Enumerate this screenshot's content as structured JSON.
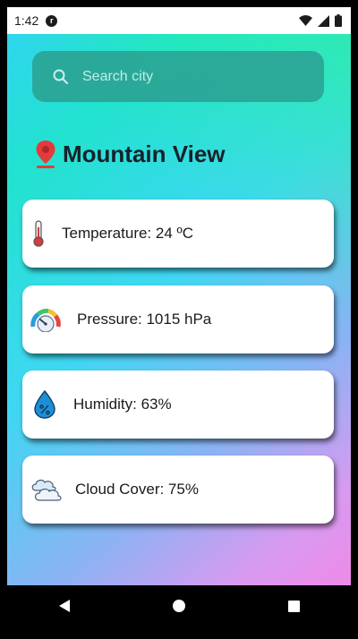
{
  "status_bar": {
    "time": "1:42",
    "app_icon_letter": "r"
  },
  "search": {
    "placeholder": "Search city",
    "icon": "search-icon"
  },
  "location": {
    "city": "Mountain View",
    "icon": "map-pin-icon"
  },
  "weather_cards": [
    {
      "icon": "thermometer-icon",
      "text": "Temperature: 24 ºC"
    },
    {
      "icon": "pressure-gauge-icon",
      "text": "Pressure: 1015 hPa"
    },
    {
      "icon": "humidity-drop-icon",
      "text": "Humidity: 63%"
    },
    {
      "icon": "cloud-icon",
      "text": "Cloud Cover: 75%"
    }
  ],
  "nav_bar": {
    "back": "back-icon",
    "home": "home-icon",
    "recents": "recents-icon"
  },
  "colors": {
    "search_bg": "#2ba596",
    "city_text": "#17212b",
    "pin_red": "#e23b3b",
    "drop_blue": "#1e8fd6"
  }
}
